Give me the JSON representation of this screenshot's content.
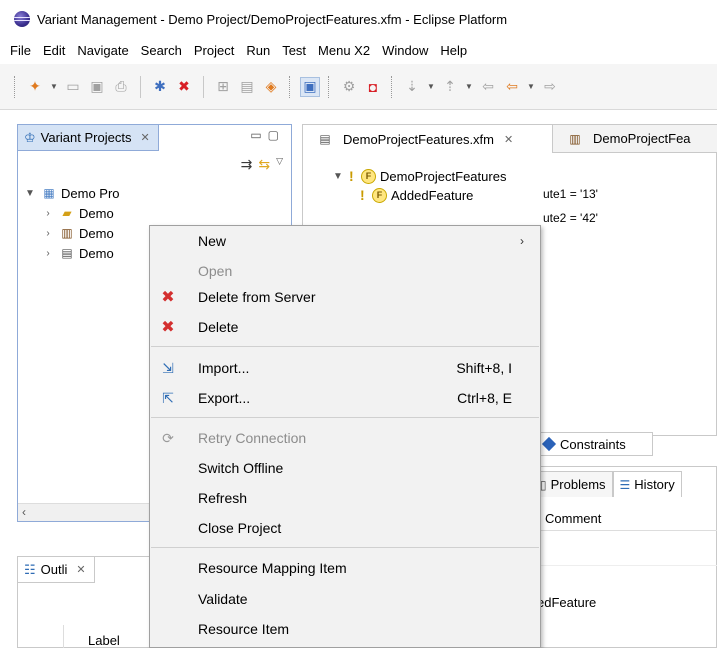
{
  "window": {
    "title": "Variant Management - Demo Project/DemoProjectFeatures.xfm - Eclipse Platform"
  },
  "menubar": {
    "items": [
      "File",
      "Edit",
      "Navigate",
      "Search",
      "Project",
      "Run",
      "Test",
      "Menu X2",
      "Window",
      "Help"
    ]
  },
  "left_view": {
    "tab_label": "Variant Projects",
    "tab_close": "✕",
    "tree": [
      {
        "label": "Demo Pro",
        "level": 0,
        "expanded": true,
        "icon": "project-icon"
      },
      {
        "label": "Demo",
        "level": 1,
        "expanded": false,
        "icon": "folder-icon"
      },
      {
        "label": "Demo",
        "level": 1,
        "expanded": false,
        "icon": "model-icon"
      },
      {
        "label": "Demo",
        "level": 1,
        "expanded": false,
        "icon": "file-icon"
      }
    ]
  },
  "outline_view": {
    "tab_label": "Outli",
    "tab_close": "✕",
    "column_label": "Label"
  },
  "editor": {
    "active_tab": "DemoProjectFeatures.xfm",
    "active_tab_close": "✕",
    "other_tab": "DemoProjectFea",
    "tree": {
      "root": "DemoProjectFeatures",
      "child": "AddedFeature"
    },
    "attributes": [
      "ute1 = '13'",
      "ute2 = '42'"
    ],
    "bottom_tab": "Constraints"
  },
  "bottom_right": {
    "tabs": [
      "Problems",
      "History"
    ],
    "column_header": "Comment",
    "cell": "edFeature"
  },
  "context_menu": {
    "items": [
      {
        "label": "New",
        "submenu": true,
        "disabled": false,
        "icon": ""
      },
      {
        "label": "Open",
        "disabled": true,
        "icon": ""
      },
      {
        "label": "Delete from Server",
        "disabled": false,
        "icon": "red-x-icon"
      },
      {
        "label": "Delete",
        "disabled": false,
        "icon": "red-x-icon"
      },
      {
        "label": "Import...",
        "shortcut": "Shift+8, I",
        "disabled": false,
        "icon": "import-icon"
      },
      {
        "label": "Export...",
        "shortcut": "Ctrl+8, E",
        "disabled": false,
        "icon": "export-icon"
      },
      {
        "label": "Retry Connection",
        "disabled": true,
        "icon": "retry-icon"
      },
      {
        "label": "Switch Offline",
        "disabled": false,
        "icon": ""
      },
      {
        "label": "Refresh",
        "disabled": false,
        "icon": ""
      },
      {
        "label": "Close Project",
        "disabled": false,
        "icon": ""
      },
      {
        "label": "Resource Mapping Item",
        "disabled": false,
        "icon": ""
      },
      {
        "label": "Validate",
        "disabled": false,
        "icon": ""
      },
      {
        "label": "Resource Item",
        "disabled": false,
        "icon": ""
      }
    ],
    "submenu_arrow": "›"
  },
  "colors": {
    "active_view_border": "#8faad8",
    "active_tab_bg": "#d5e3f5",
    "menu_bg": "#f2f2f2",
    "disabled_text": "#8c8c8c",
    "delete_red": "#d32f2f"
  }
}
